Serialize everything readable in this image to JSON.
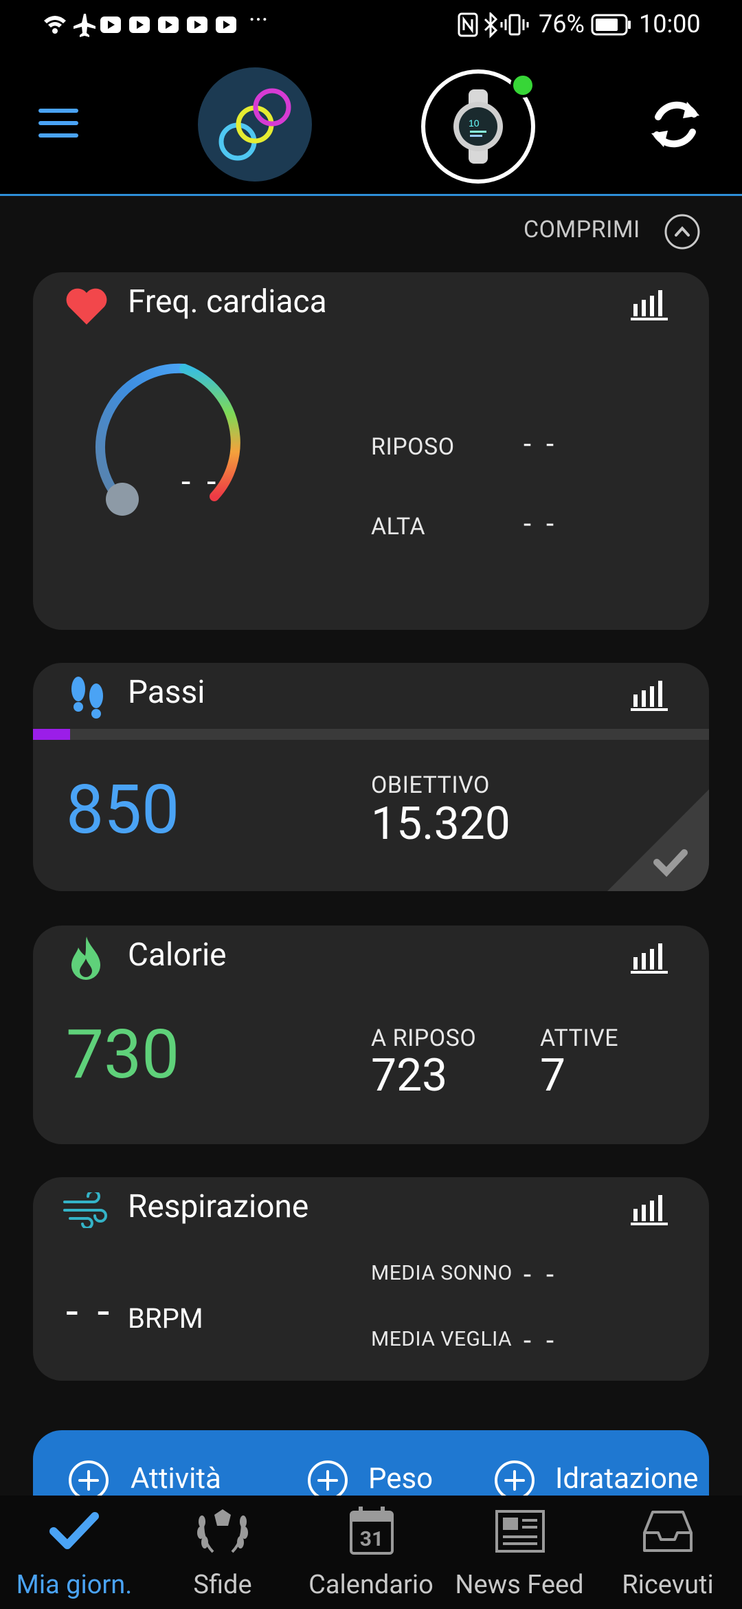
{
  "status_bar": {
    "battery_percent": "76%",
    "time": "10:00",
    "overflow": "···"
  },
  "header": {
    "menu_icon": "hamburger-icon",
    "app_logo": "connect-rings-logo",
    "device": "watch-device-icon",
    "device_connected": true,
    "sync_icon": "sync-icon"
  },
  "collapse": {
    "label": "COMPRIMI"
  },
  "heart_rate": {
    "title": "Freq. cardiaca",
    "current": "- -",
    "rest_label": "RIPOSO",
    "rest_value": "- -",
    "high_label": "ALTA",
    "high_value": "- -"
  },
  "steps": {
    "title": "Passi",
    "value": "850",
    "goal_label": "OBIETTIVO",
    "goal_value": "15.320",
    "progress": 0.055
  },
  "calories": {
    "title": "Calorie",
    "value": "730",
    "resting_label": "A RIPOSO",
    "resting_value": "723",
    "active_label": "ATTIVE",
    "active_value": "7"
  },
  "respiration": {
    "title": "Respirazione",
    "value": "- -",
    "unit": "BRPM",
    "sleep_avg_label": "MEDIA SONNO",
    "sleep_avg_value": "- -",
    "awake_avg_label": "MEDIA VEGLIA",
    "awake_avg_value": "- -"
  },
  "quick_add": {
    "activity": "Attività",
    "weight": "Peso",
    "hydration": "Idratazione"
  },
  "bottom_nav": {
    "my_day": "Mia giorn.",
    "challenges": "Sfide",
    "calendar": "Calendario",
    "calendar_day": "31",
    "news_feed": "News Feed",
    "inbox": "Ricevuti"
  },
  "colors": {
    "accent_blue": "#4aa3f5",
    "calorie_green": "#5fd17a",
    "quick_bar_blue": "#1f78d1",
    "steps_progress_purple": "#9b1ee8"
  }
}
